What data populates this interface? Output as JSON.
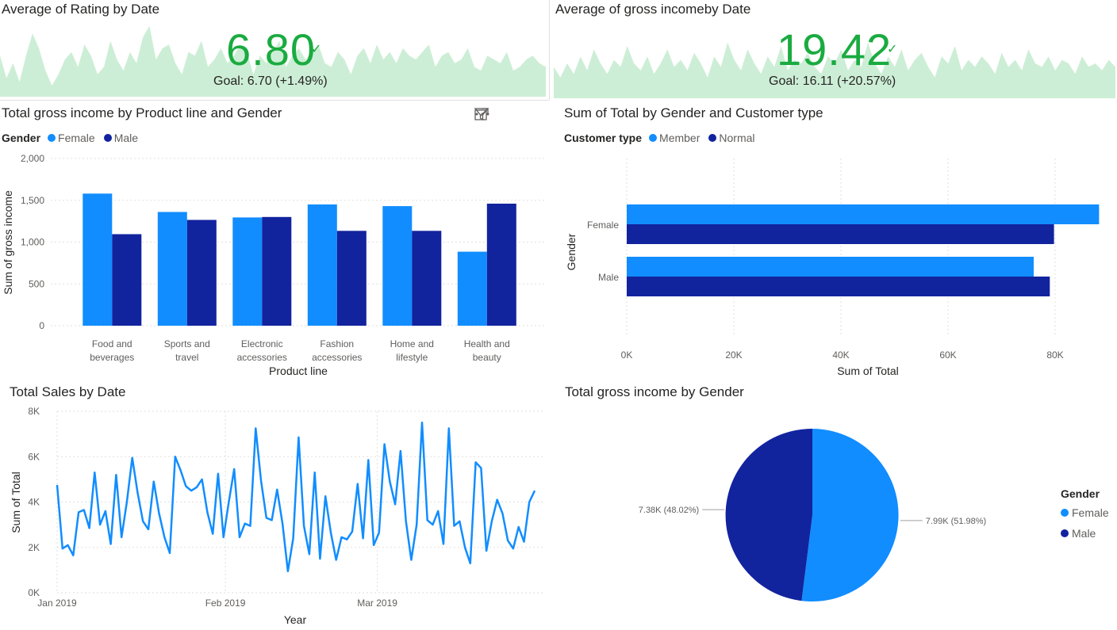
{
  "kpi_rating": {
    "title": "Average of Rating by Date",
    "value": "6.80",
    "check": "✓",
    "goal": "Goal: 6.70 (+1.49%)",
    "spark": [
      0.55,
      0.25,
      0.45,
      0.2,
      0.55,
      0.85,
      0.65,
      0.35,
      0.15,
      0.3,
      0.5,
      0.6,
      0.4,
      0.7,
      0.55,
      0.3,
      0.4,
      0.75,
      0.5,
      0.35,
      0.6,
      0.45,
      0.8,
      0.95,
      0.5,
      0.65,
      0.7,
      0.45,
      0.3,
      0.6,
      0.55,
      0.75,
      0.4,
      0.5,
      0.65,
      0.45,
      0.55,
      0.7,
      0.6,
      0.3,
      0.55,
      0.45,
      0.6,
      0.75,
      0.4,
      0.55,
      0.65,
      0.5,
      0.6,
      0.7,
      0.45,
      0.4,
      0.6,
      0.5,
      0.3,
      0.55,
      0.65,
      0.45,
      0.7,
      0.5,
      0.6,
      0.45,
      0.65,
      0.55,
      0.5,
      0.6,
      0.7,
      0.4,
      0.55,
      0.6,
      0.45,
      0.5,
      0.65,
      0.4,
      0.35,
      0.55,
      0.5,
      0.45,
      0.6,
      0.35,
      0.4,
      0.5,
      0.55,
      0.45,
      0.4
    ]
  },
  "kpi_income": {
    "title": "Average of gross incomeby Date",
    "value": "19.42",
    "check": "✓",
    "goal": "Goal: 16.11 (+20.57%)",
    "spark": [
      0.45,
      0.3,
      0.5,
      0.35,
      0.6,
      0.4,
      0.7,
      0.5,
      0.35,
      0.55,
      0.45,
      0.75,
      0.5,
      0.4,
      0.6,
      0.35,
      0.5,
      0.7,
      0.45,
      0.55,
      0.4,
      0.65,
      0.5,
      0.3,
      0.6,
      0.45,
      0.8,
      0.55,
      0.4,
      0.7,
      0.5,
      0.35,
      0.6,
      0.45,
      0.75,
      0.4,
      0.55,
      0.5,
      0.65,
      0.45,
      0.35,
      0.6,
      0.5,
      0.7,
      0.4,
      0.55,
      0.45,
      0.8,
      0.5,
      0.35,
      0.6,
      0.45,
      0.7,
      0.4,
      0.55,
      0.65,
      0.45,
      0.3,
      0.6,
      0.5,
      0.75,
      0.4,
      0.55,
      0.45,
      0.6,
      0.5,
      0.35,
      0.65,
      0.45,
      0.55,
      0.4,
      0.7,
      0.5,
      0.45,
      0.6,
      0.4,
      0.55,
      0.5,
      0.35,
      0.6,
      0.45,
      0.5,
      0.4,
      0.55,
      0.45
    ]
  },
  "bar_chart": {
    "title": "Total gross income by Product line and Gender",
    "legend_title": "Gender",
    "icons": {
      "filter": "filter-icon",
      "focus": "focus-mode-icon",
      "more": "more-options-icon"
    },
    "chart_data": {
      "type": "bar",
      "categories": [
        [
          "Food and",
          "beverages"
        ],
        [
          "Sports and",
          "travel"
        ],
        [
          "Electronic",
          "accessories"
        ],
        [
          "Fashion",
          "accessories"
        ],
        [
          "Home and",
          "lifestyle"
        ],
        [
          "Health and",
          "beauty"
        ]
      ],
      "series": [
        {
          "name": "Female",
          "color": "#118dff",
          "values": [
            1580,
            1360,
            1295,
            1450,
            1430,
            885
          ]
        },
        {
          "name": "Male",
          "color": "#12239e",
          "values": [
            1095,
            1265,
            1300,
            1135,
            1135,
            1460
          ]
        }
      ],
      "xlabel": "Product line",
      "ylabel": "Sum of gross income",
      "yticks": [
        "0",
        "500",
        "1,000",
        "1,500",
        "2,000"
      ],
      "ylim": [
        0,
        2000
      ]
    }
  },
  "hbar_chart": {
    "title": "Sum of Total by Gender and Customer type",
    "legend_title": "Customer type",
    "chart_data": {
      "type": "bar",
      "orientation": "horizontal",
      "categories": [
        "Female",
        "Male"
      ],
      "series": [
        {
          "name": "Member",
          "color": "#118dff",
          "values": [
            88200,
            76000
          ]
        },
        {
          "name": "Normal",
          "color": "#12239e",
          "values": [
            79800,
            79000
          ]
        }
      ],
      "xlabel": "Sum of Total",
      "ylabel": "Gender",
      "xticks": [
        "0K",
        "20K",
        "40K",
        "60K",
        "80K"
      ],
      "xlim": [
        0,
        80000
      ]
    }
  },
  "line_chart": {
    "title": "Total Sales by Date",
    "chart_data": {
      "type": "line",
      "color": "#118dff",
      "xlabel": "Year",
      "ylabel": "Sum of Total",
      "yticks": [
        "0K",
        "2K",
        "4K",
        "6K",
        "8K"
      ],
      "ylim": [
        0,
        8000
      ],
      "xticks": [
        "Jan 2019",
        "Feb 2019",
        "Mar 2019"
      ],
      "x_start": "2019-01-01",
      "x_end": "2019-03-30",
      "values": [
        4750,
        1950,
        2100,
        1650,
        3550,
        3650,
        2850,
        5300,
        3000,
        3600,
        2150,
        5200,
        2450,
        4000,
        5950,
        4400,
        3150,
        2800,
        4900,
        3500,
        2450,
        1750,
        6000,
        5400,
        4700,
        4500,
        4650,
        5000,
        3550,
        2600,
        5250,
        2450,
        4000,
        5450,
        2450,
        3050,
        2950,
        7250,
        4950,
        3300,
        3200,
        4550,
        3050,
        950,
        2400,
        6850,
        2950,
        1700,
        5300,
        1500,
        4250,
        2650,
        1450,
        2450,
        2350,
        2700,
        4800,
        2400,
        5850,
        2100,
        2650,
        6550,
        4900,
        3900,
        6250,
        3150,
        1450,
        3000,
        7500,
        3200,
        3000,
        3600,
        2150,
        7250,
        2950,
        3150,
        2000,
        1300,
        5750,
        5500,
        1850,
        3150,
        4100,
        3500,
        2300,
        1950,
        2900,
        2250,
        4000,
        4500
      ]
    }
  },
  "pie_chart": {
    "title": "Total gross income by Gender",
    "legend_title": "Gender",
    "chart_data": {
      "type": "pie",
      "slices": [
        {
          "name": "Female",
          "value": 7990,
          "percent": 51.98,
          "label": "7.99K (51.98%)",
          "color": "#118dff"
        },
        {
          "name": "Male",
          "value": 7380,
          "percent": 48.02,
          "label": "7.38K (48.02%)",
          "color": "#12239e"
        }
      ]
    }
  }
}
